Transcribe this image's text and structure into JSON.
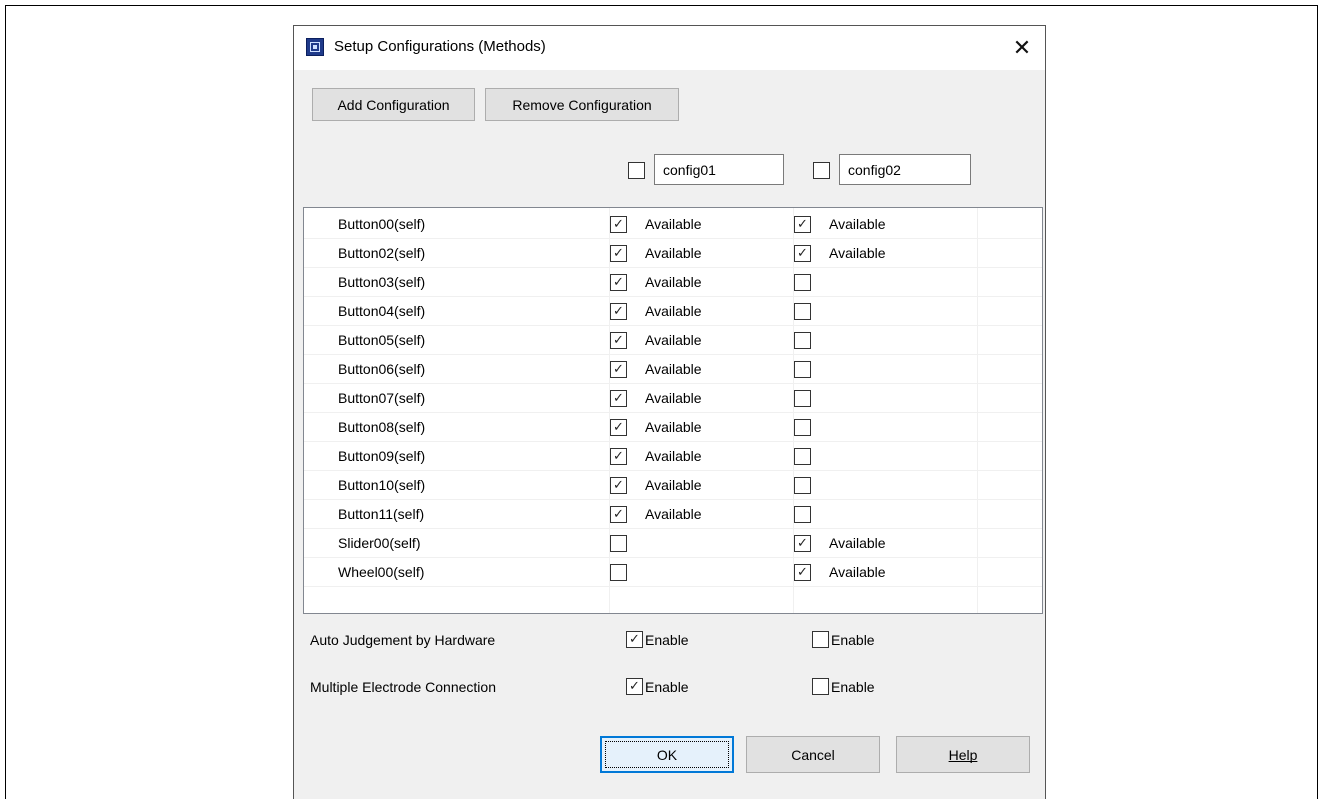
{
  "dialog": {
    "title": "Setup Configurations (Methods)",
    "close_label": "✕"
  },
  "toolbar": {
    "add_label": "Add Configuration",
    "remove_label": "Remove Configuration"
  },
  "configs": [
    {
      "name": "config01",
      "selected": false
    },
    {
      "name": "config02",
      "selected": false
    }
  ],
  "available_label": "Available",
  "rows": [
    {
      "name": "Button00(self)",
      "config01": true,
      "config02": true
    },
    {
      "name": "Button02(self)",
      "config01": true,
      "config02": true
    },
    {
      "name": "Button03(self)",
      "config01": true,
      "config02": false
    },
    {
      "name": "Button04(self)",
      "config01": true,
      "config02": false
    },
    {
      "name": "Button05(self)",
      "config01": true,
      "config02": false
    },
    {
      "name": "Button06(self)",
      "config01": true,
      "config02": false
    },
    {
      "name": "Button07(self)",
      "config01": true,
      "config02": false
    },
    {
      "name": "Button08(self)",
      "config01": true,
      "config02": false
    },
    {
      "name": "Button09(self)",
      "config01": true,
      "config02": false
    },
    {
      "name": "Button10(self)",
      "config01": true,
      "config02": false
    },
    {
      "name": "Button11(self)",
      "config01": true,
      "config02": false
    },
    {
      "name": "Slider00(self)",
      "config01": false,
      "config02": true
    },
    {
      "name": "Wheel00(self)",
      "config01": false,
      "config02": true
    }
  ],
  "options": [
    {
      "label": "Auto Judgement by Hardware",
      "enable_label": "Enable",
      "config01": true,
      "config02": false
    },
    {
      "label": "Multiple Electrode Connection",
      "enable_label": "Enable",
      "config01": true,
      "config02": false
    }
  ],
  "footer": {
    "ok_label": "OK",
    "cancel_label": "Cancel",
    "help_label": "Help"
  }
}
